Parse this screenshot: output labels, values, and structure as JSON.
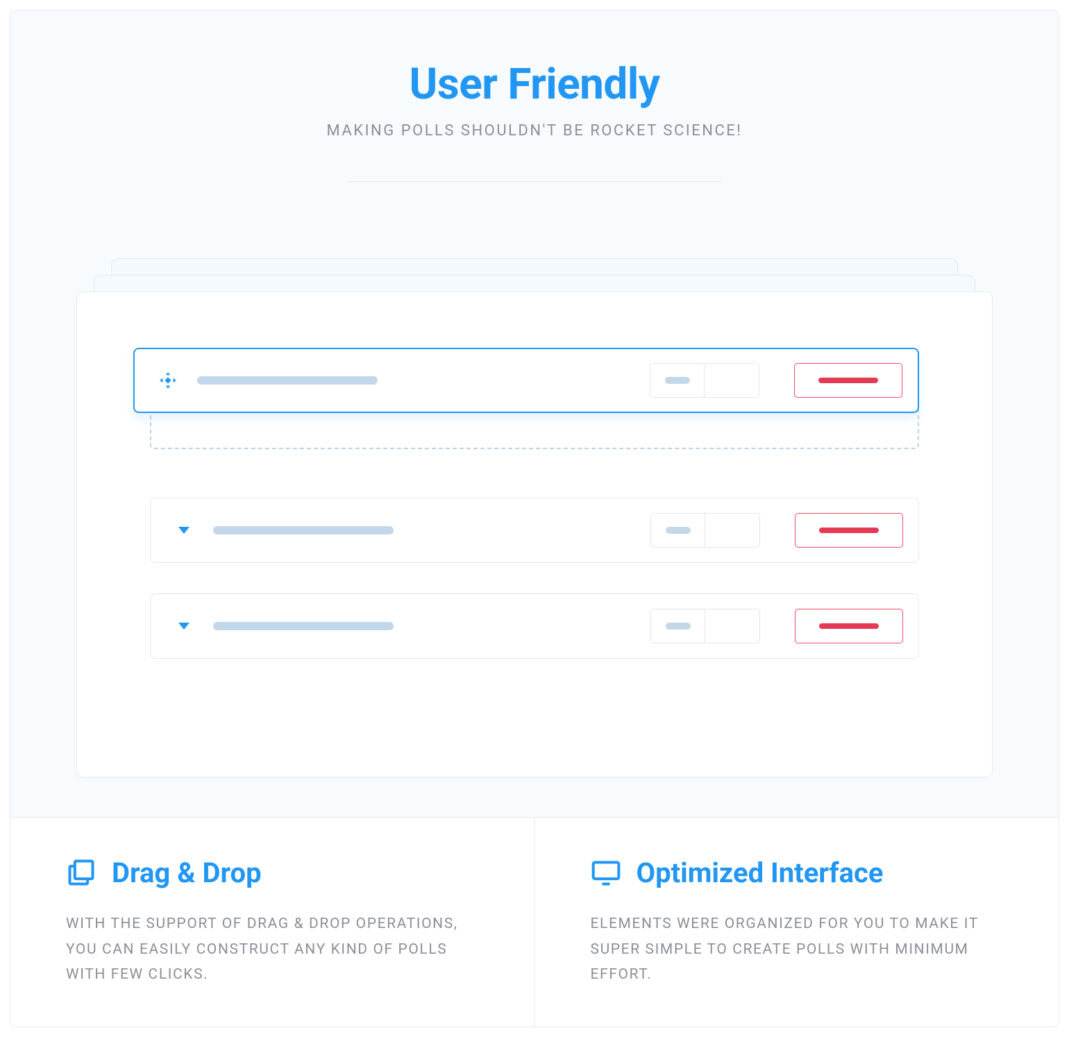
{
  "hero": {
    "title": "User Friendly",
    "subtitle": "MAKING POLLS SHOULDN'T BE ROCKET SCIENCE!"
  },
  "features": {
    "drag_drop": {
      "title": "Drag & Drop",
      "desc": "WITH THE SUPPORT OF DRAG & DROP OPERATIONS, YOU CAN EASILY CONSTRUCT ANY KIND OF POLLS WITH FEW CLICKS."
    },
    "optimized": {
      "title": "Optimized Interface",
      "desc": "ELEMENTS WERE ORGANIZED FOR YOU TO MAKE IT SUPER SIMPLE TO CREATE POLLS WITH MINIMUM EFFORT."
    }
  },
  "colors": {
    "accent": "#2196f3",
    "danger": "#e33a55"
  }
}
